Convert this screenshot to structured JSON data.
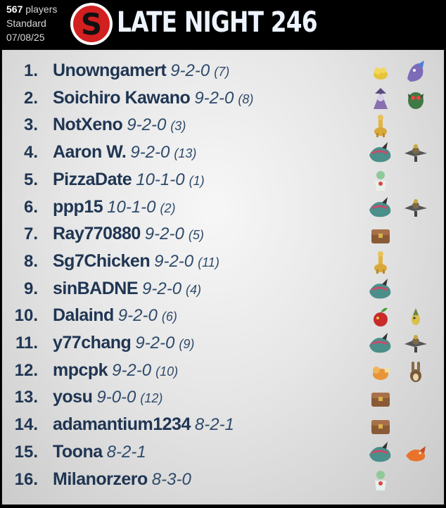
{
  "header": {
    "players_count": "567",
    "players_label": "players",
    "format": "Standard",
    "date": "07/08/25",
    "logo_letter": "S",
    "event_title": "LATE NIGHT 246"
  },
  "colors": {
    "header_bg": "#000000",
    "title_text": "#eef4ff",
    "logo_red": "#d21f1f",
    "rank_text": "#1f3552",
    "panel_bg": "#e8e8e8"
  },
  "standings": [
    {
      "rank": "1.",
      "name": "Unowngamert",
      "record": "9-2-0",
      "seed": "(7)",
      "sprites": [
        "yellow-blob-sprite",
        "purple-dragon-sprite"
      ]
    },
    {
      "rank": "2.",
      "name": "Soichiro Kawano",
      "record": "9-2-0",
      "seed": "(8)",
      "sprites": [
        "purple-wizard-sprite",
        "green-owl-sprite"
      ]
    },
    {
      "rank": "3.",
      "name": "NotXeno",
      "record": "9-2-0",
      "seed": "(3)",
      "sprites": [
        "yellow-giraffe-sprite"
      ]
    },
    {
      "rank": "4.",
      "name": "Aaron W.",
      "record": "9-2-0",
      "seed": "(13)",
      "sprites": [
        "teal-dragon-sprite",
        "dark-bird-sprite"
      ]
    },
    {
      "rank": "5.",
      "name": "PizzaDate",
      "record": "10-1-0",
      "seed": "(1)",
      "sprites": [
        "green-dancer-sprite"
      ]
    },
    {
      "rank": "6.",
      "name": "ppp15",
      "record": "10-1-0",
      "seed": "(2)",
      "sprites": [
        "teal-dragon-sprite",
        "dark-bird-sprite"
      ]
    },
    {
      "rank": "7.",
      "name": "Ray770880",
      "record": "9-2-0",
      "seed": "(5)",
      "sprites": [
        "brown-chest-sprite"
      ]
    },
    {
      "rank": "8.",
      "name": "Sg7Chicken",
      "record": "9-2-0",
      "seed": "(11)",
      "sprites": [
        "yellow-giraffe-sprite"
      ]
    },
    {
      "rank": "9.",
      "name": "sinBADNE",
      "record": "9-2-0",
      "seed": "(4)",
      "sprites": [
        "teal-dragon-sprite"
      ]
    },
    {
      "rank": "10.",
      "name": "Dalaind",
      "record": "9-2-0",
      "seed": "(6)",
      "sprites": [
        "red-apple-sprite",
        "small-yellow-sprite"
      ]
    },
    {
      "rank": "11.",
      "name": "y77chang",
      "record": "9-2-0",
      "seed": "(9)",
      "sprites": [
        "teal-dragon-sprite",
        "dark-bird-sprite"
      ]
    },
    {
      "rank": "12.",
      "name": "mpcpk",
      "record": "9-2-0",
      "seed": "(10)",
      "sprites": [
        "orange-fox-sprite",
        "brown-rabbit-sprite"
      ]
    },
    {
      "rank": "13.",
      "name": "yosu",
      "record": "9-0-0",
      "seed": "(12)",
      "sprites": [
        "brown-chest-sprite"
      ]
    },
    {
      "rank": "14.",
      "name": "adamantium1234",
      "record": "8-2-1",
      "seed": "",
      "sprites": [
        "brown-chest-sprite"
      ]
    },
    {
      "rank": "15.",
      "name": "Toona",
      "record": "8-2-1",
      "seed": "",
      "sprites": [
        "teal-dragon-sprite",
        "orange-lizard-sprite"
      ]
    },
    {
      "rank": "16.",
      "name": "Milanorzero",
      "record": "8-3-0",
      "seed": "",
      "sprites": [
        "green-dancer-sprite"
      ]
    }
  ]
}
